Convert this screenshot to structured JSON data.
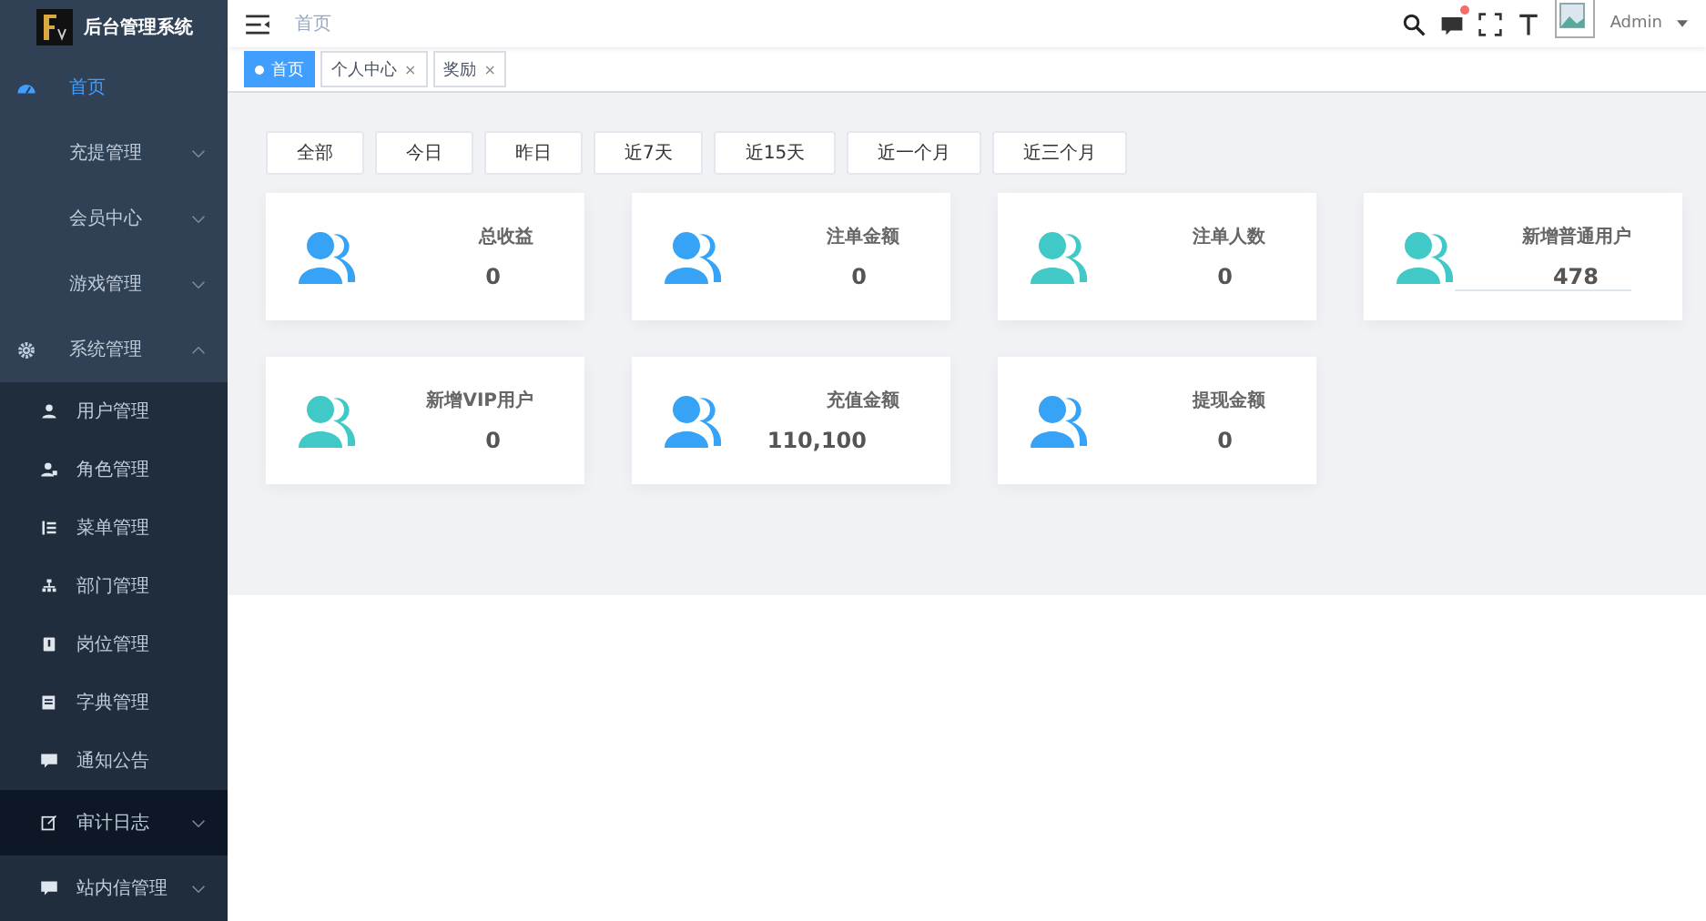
{
  "sidebar": {
    "title": "后台管理系统",
    "items": [
      {
        "label": "首页",
        "kind": "dashboard",
        "selected": true,
        "expanded": false,
        "has_submenu": false
      },
      {
        "label": "充提管理",
        "kind": "plain",
        "selected": false,
        "expanded": false,
        "has_submenu": true
      },
      {
        "label": "会员中心",
        "kind": "plain",
        "selected": false,
        "expanded": false,
        "has_submenu": true
      },
      {
        "label": "游戏管理",
        "kind": "plain",
        "selected": false,
        "expanded": false,
        "has_submenu": true
      },
      {
        "label": "系统管理",
        "kind": "gear",
        "selected": false,
        "expanded": true,
        "has_submenu": true,
        "children": [
          {
            "label": "用户管理",
            "kind": "user",
            "highlighted": false,
            "has_submenu": false
          },
          {
            "label": "角色管理",
            "kind": "role",
            "highlighted": false,
            "has_submenu": false
          },
          {
            "label": "菜单管理",
            "kind": "list",
            "highlighted": false,
            "has_submenu": false
          },
          {
            "label": "部门管理",
            "kind": "tree",
            "highlighted": false,
            "has_submenu": false
          },
          {
            "label": "岗位管理",
            "kind": "post",
            "highlighted": false,
            "has_submenu": false
          },
          {
            "label": "字典管理",
            "kind": "dict",
            "highlighted": false,
            "has_submenu": false
          },
          {
            "label": "通知公告",
            "kind": "message",
            "highlighted": false,
            "has_submenu": false
          },
          {
            "label": "审计日志",
            "kind": "edit",
            "highlighted": true,
            "has_submenu": true
          },
          {
            "label": "站内信管理",
            "kind": "message",
            "highlighted": false,
            "has_submenu": true
          }
        ]
      }
    ]
  },
  "header": {
    "breadcrumb": "首页",
    "user": "Admin",
    "notification_dot": true
  },
  "tags": [
    {
      "label": "首页",
      "selected": true,
      "closable": false
    },
    {
      "label": "个人中心",
      "selected": false,
      "closable": true
    },
    {
      "label": "奖励",
      "selected": false,
      "closable": true
    }
  ],
  "close_glyph": "×",
  "date_filters": [
    "全部",
    "今日",
    "昨日",
    "近7天",
    "近15天",
    "近一个月",
    "近三个月"
  ],
  "stats": [
    {
      "label": "总收益",
      "value": "0",
      "color": "#36a3f7",
      "underline": false
    },
    {
      "label": "注单金额",
      "value": "0",
      "color": "#36a3f7",
      "underline": false
    },
    {
      "label": "注单人数",
      "value": "0",
      "color": "#40c9c6",
      "underline": false
    },
    {
      "label": "新增普通用户",
      "value": "478",
      "color": "#40c9c6",
      "underline": true
    },
    {
      "label": "新增VIP用户",
      "value": "0",
      "color": "#40c9c6",
      "underline": false
    },
    {
      "label": "充值金额",
      "value": "110,100",
      "color": "#36a3f7",
      "underline": false
    },
    {
      "label": "提现金额",
      "value": "0",
      "color": "#36a3f7",
      "underline": false
    }
  ]
}
